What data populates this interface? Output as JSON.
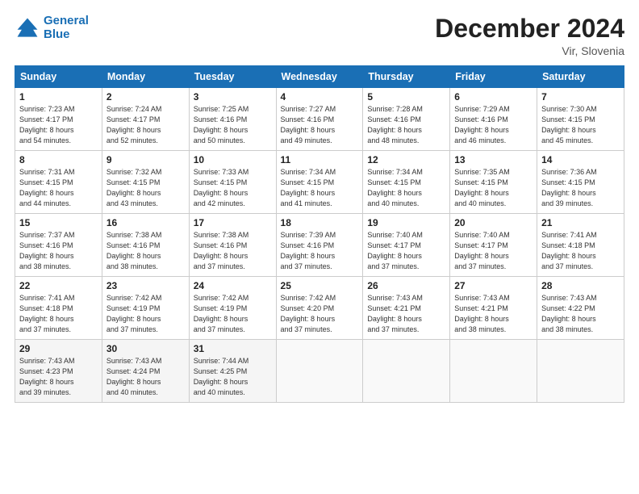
{
  "header": {
    "logo_line1": "General",
    "logo_line2": "Blue",
    "month_title": "December 2024",
    "location": "Vir, Slovenia"
  },
  "weekdays": [
    "Sunday",
    "Monday",
    "Tuesday",
    "Wednesday",
    "Thursday",
    "Friday",
    "Saturday"
  ],
  "weeks": [
    [
      {
        "day": "1",
        "info": "Sunrise: 7:23 AM\nSunset: 4:17 PM\nDaylight: 8 hours\nand 54 minutes."
      },
      {
        "day": "2",
        "info": "Sunrise: 7:24 AM\nSunset: 4:17 PM\nDaylight: 8 hours\nand 52 minutes."
      },
      {
        "day": "3",
        "info": "Sunrise: 7:25 AM\nSunset: 4:16 PM\nDaylight: 8 hours\nand 50 minutes."
      },
      {
        "day": "4",
        "info": "Sunrise: 7:27 AM\nSunset: 4:16 PM\nDaylight: 8 hours\nand 49 minutes."
      },
      {
        "day": "5",
        "info": "Sunrise: 7:28 AM\nSunset: 4:16 PM\nDaylight: 8 hours\nand 48 minutes."
      },
      {
        "day": "6",
        "info": "Sunrise: 7:29 AM\nSunset: 4:16 PM\nDaylight: 8 hours\nand 46 minutes."
      },
      {
        "day": "7",
        "info": "Sunrise: 7:30 AM\nSunset: 4:15 PM\nDaylight: 8 hours\nand 45 minutes."
      }
    ],
    [
      {
        "day": "8",
        "info": "Sunrise: 7:31 AM\nSunset: 4:15 PM\nDaylight: 8 hours\nand 44 minutes."
      },
      {
        "day": "9",
        "info": "Sunrise: 7:32 AM\nSunset: 4:15 PM\nDaylight: 8 hours\nand 43 minutes."
      },
      {
        "day": "10",
        "info": "Sunrise: 7:33 AM\nSunset: 4:15 PM\nDaylight: 8 hours\nand 42 minutes."
      },
      {
        "day": "11",
        "info": "Sunrise: 7:34 AM\nSunset: 4:15 PM\nDaylight: 8 hours\nand 41 minutes."
      },
      {
        "day": "12",
        "info": "Sunrise: 7:34 AM\nSunset: 4:15 PM\nDaylight: 8 hours\nand 40 minutes."
      },
      {
        "day": "13",
        "info": "Sunrise: 7:35 AM\nSunset: 4:15 PM\nDaylight: 8 hours\nand 40 minutes."
      },
      {
        "day": "14",
        "info": "Sunrise: 7:36 AM\nSunset: 4:15 PM\nDaylight: 8 hours\nand 39 minutes."
      }
    ],
    [
      {
        "day": "15",
        "info": "Sunrise: 7:37 AM\nSunset: 4:16 PM\nDaylight: 8 hours\nand 38 minutes."
      },
      {
        "day": "16",
        "info": "Sunrise: 7:38 AM\nSunset: 4:16 PM\nDaylight: 8 hours\nand 38 minutes."
      },
      {
        "day": "17",
        "info": "Sunrise: 7:38 AM\nSunset: 4:16 PM\nDaylight: 8 hours\nand 37 minutes."
      },
      {
        "day": "18",
        "info": "Sunrise: 7:39 AM\nSunset: 4:16 PM\nDaylight: 8 hours\nand 37 minutes."
      },
      {
        "day": "19",
        "info": "Sunrise: 7:40 AM\nSunset: 4:17 PM\nDaylight: 8 hours\nand 37 minutes."
      },
      {
        "day": "20",
        "info": "Sunrise: 7:40 AM\nSunset: 4:17 PM\nDaylight: 8 hours\nand 37 minutes."
      },
      {
        "day": "21",
        "info": "Sunrise: 7:41 AM\nSunset: 4:18 PM\nDaylight: 8 hours\nand 37 minutes."
      }
    ],
    [
      {
        "day": "22",
        "info": "Sunrise: 7:41 AM\nSunset: 4:18 PM\nDaylight: 8 hours\nand 37 minutes."
      },
      {
        "day": "23",
        "info": "Sunrise: 7:42 AM\nSunset: 4:19 PM\nDaylight: 8 hours\nand 37 minutes."
      },
      {
        "day": "24",
        "info": "Sunrise: 7:42 AM\nSunset: 4:19 PM\nDaylight: 8 hours\nand 37 minutes."
      },
      {
        "day": "25",
        "info": "Sunrise: 7:42 AM\nSunset: 4:20 PM\nDaylight: 8 hours\nand 37 minutes."
      },
      {
        "day": "26",
        "info": "Sunrise: 7:43 AM\nSunset: 4:21 PM\nDaylight: 8 hours\nand 37 minutes."
      },
      {
        "day": "27",
        "info": "Sunrise: 7:43 AM\nSunset: 4:21 PM\nDaylight: 8 hours\nand 38 minutes."
      },
      {
        "day": "28",
        "info": "Sunrise: 7:43 AM\nSunset: 4:22 PM\nDaylight: 8 hours\nand 38 minutes."
      }
    ],
    [
      {
        "day": "29",
        "info": "Sunrise: 7:43 AM\nSunset: 4:23 PM\nDaylight: 8 hours\nand 39 minutes."
      },
      {
        "day": "30",
        "info": "Sunrise: 7:43 AM\nSunset: 4:24 PM\nDaylight: 8 hours\nand 40 minutes."
      },
      {
        "day": "31",
        "info": "Sunrise: 7:44 AM\nSunset: 4:25 PM\nDaylight: 8 hours\nand 40 minutes."
      },
      {
        "day": "",
        "info": ""
      },
      {
        "day": "",
        "info": ""
      },
      {
        "day": "",
        "info": ""
      },
      {
        "day": "",
        "info": ""
      }
    ]
  ]
}
